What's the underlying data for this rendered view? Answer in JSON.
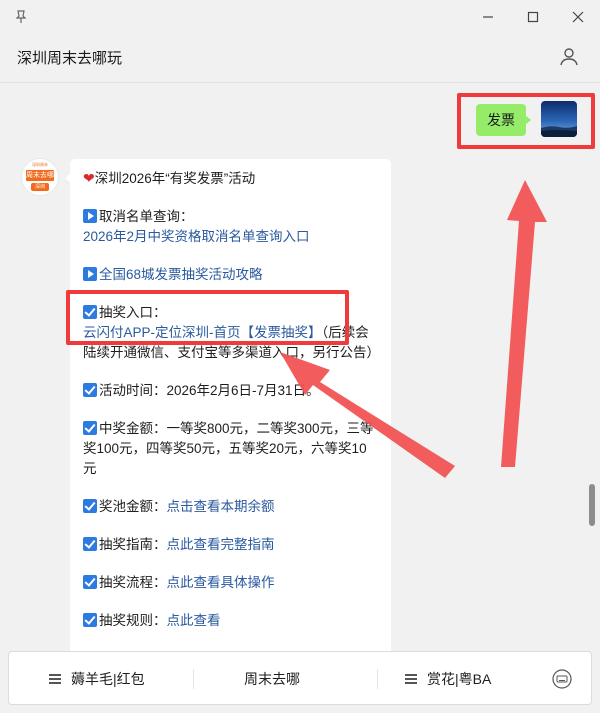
{
  "window": {
    "pin_icon": "pin-icon",
    "minimize_icon": "minimize-icon",
    "maximize_icon": "maximize-icon",
    "close_icon": "close-icon"
  },
  "header": {
    "title": "深圳周末去哪玩",
    "user_icon": "user-profile-icon"
  },
  "sent_message": {
    "text": "发票"
  },
  "bot_avatar": {
    "brand_top": "周末去哪",
    "brand_bottom": "深圳",
    "tiny": "深圳周末"
  },
  "message": {
    "title": "深圳2026年“有奖发票”活动",
    "s1_label": "取消名单查询：",
    "s1_link": "2026年2月中奖资格取消名单查询入口",
    "s2_link": "全国68城发票抽奖活动攻略",
    "s3_label": "抽奖入口：",
    "s3_link": "云闪付APP-定位深圳-首页【发票抽奖】",
    "s3_note": "（后续会陆续开通微信、支付宝等多渠道入口，另行公告）",
    "s4_label": "活动时间：",
    "s4_value": "2026年2月6日-7月31日。",
    "s5_label": "中奖金额：",
    "s5_value": "一等奖800元，二等奖300元，三等奖100元，四等奖50元，五等奖20元，六等奖10元",
    "s6_label": "奖池金额：",
    "s6_link": "点击查看本期余额",
    "s7_label": "抽奖指南：",
    "s7_link": "点此查看完整指南",
    "s8_label": "抽奖流程：",
    "s8_link": "点此查看具体操作",
    "s9_label": "抽奖规则：",
    "s9_link": "点此查看"
  },
  "bottom_menu": {
    "item1": "薅羊毛|红包",
    "item2": "周末去哪",
    "item3": "赏花|粤BA",
    "keyboard_icon": "keyboard-toggle-icon"
  },
  "colors": {
    "accent_red": "#ef3b3b",
    "bubble_green": "#95ec69",
    "link_blue": "#2a5a9e",
    "icon_blue": "#2b7be0"
  }
}
